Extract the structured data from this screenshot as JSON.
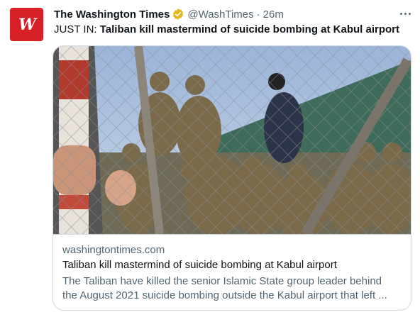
{
  "tweet": {
    "avatar_text": "W",
    "author_name": "The Washington Times",
    "handle": "@WashTimes",
    "separator": "·",
    "time": "26m",
    "text_prefix": "JUST IN: ",
    "text_highlight": "Taliban kill mastermind of suicide bombing at Kabul airport",
    "verified_color": "#e2b719",
    "brand_color": "#d71f26"
  },
  "card": {
    "domain": "washingtontimes.com",
    "title": "Taliban kill mastermind of suicide bombing at Kabul airport",
    "description_line1": "The Taliban have killed the senior Islamic State group leader behind",
    "description_line2": "the August 2021 suicide bombing outside the Kabul airport that left ..."
  }
}
